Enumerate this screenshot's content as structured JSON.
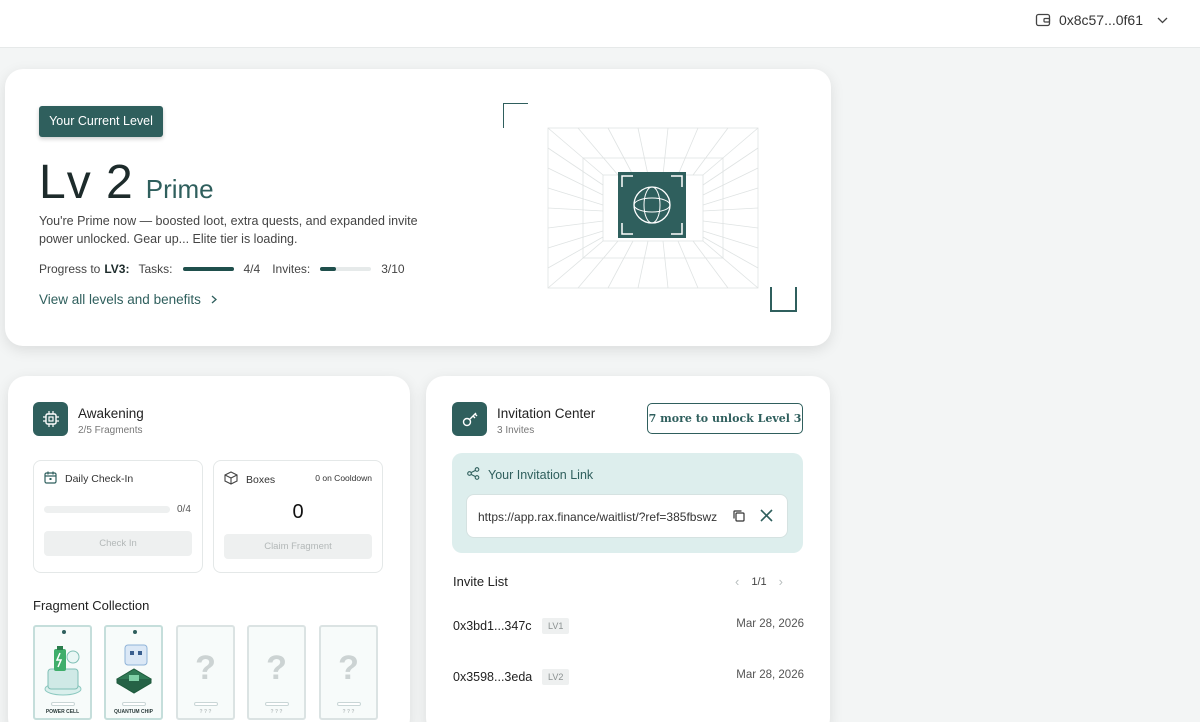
{
  "header": {
    "wallet_address": "0x8c57...0f61",
    "wallet_icon": "wallet-icon",
    "dropdown_icon": "chevron-down-icon"
  },
  "level_card": {
    "badge": "Your Current Level",
    "level": "Lv 2",
    "tier": "Prime",
    "description": "You're Prime now — boosted loot, extra quests, and expanded invite power unlocked. Gear up... Elite tier is loading.",
    "progress_label": "Progress to",
    "progress_target": "LV3:",
    "tasks_label": "Tasks:",
    "tasks_value": "4/4",
    "tasks_fraction": 1.0,
    "invites_label": "Invites:",
    "invites_value": "3/10",
    "invites_fraction": 0.3,
    "view_link": "View all levels and benefits"
  },
  "awakening": {
    "title": "Awakening",
    "subtitle": "2/5 Fragments",
    "icon": "chip-icon",
    "daily_checkin": {
      "title": "Daily Check-In",
      "progress": "0/4",
      "progress_fraction": 0,
      "button": "Check In"
    },
    "boxes": {
      "title": "Boxes",
      "cooldown": "0 on Cooldown",
      "count": "0",
      "button": "Claim Fragment"
    },
    "fragment_title": "Fragment Collection",
    "fragments": [
      {
        "name": "POWER CELL",
        "collected": true
      },
      {
        "name": "QUANTUM CHIP",
        "collected": true
      },
      {
        "name": "? ? ?",
        "collected": false
      },
      {
        "name": "? ? ?",
        "collected": false
      },
      {
        "name": "? ? ?",
        "collected": false
      }
    ]
  },
  "invitation": {
    "title": "Invitation Center",
    "subtitle": "3 Invites",
    "icon": "key-icon",
    "unlock_button": "7 more to unlock Level 3",
    "link_title": "Your Invitation Link",
    "link_url": "https://app.rax.finance/waitlist/?ref=385fbswz",
    "list_title": "Invite List",
    "page": "1/1",
    "rows": [
      {
        "address": "0x3bd1...347c",
        "level": "LV1",
        "date": "Mar 28, 2026"
      },
      {
        "address": "0x3598...3eda",
        "level": "LV2",
        "date": "Mar 28, 2026"
      }
    ]
  }
}
